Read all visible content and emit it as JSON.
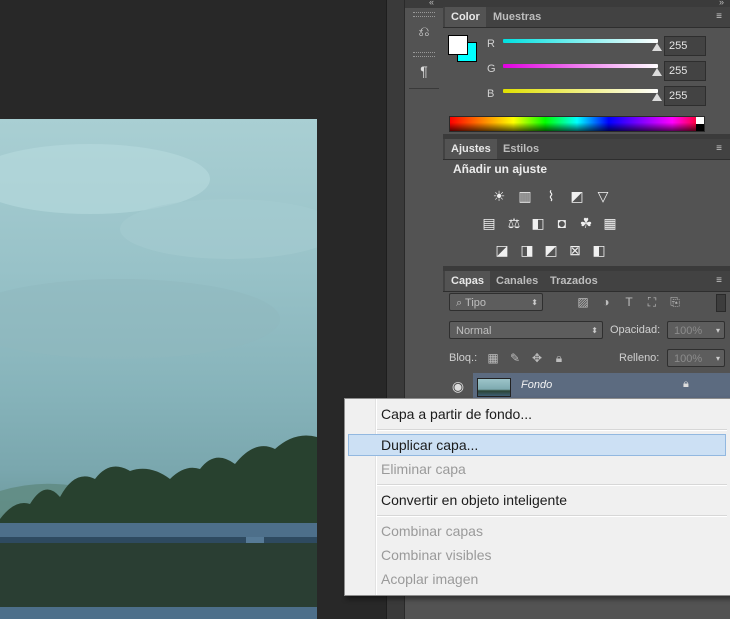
{
  "canvas": {
    "photo_desc": "landscape"
  },
  "toolstrip": {
    "icons": [
      "history-icon",
      "character-paragraph-icon"
    ]
  },
  "color_panel": {
    "tabs": [
      "Color",
      "Muestras"
    ],
    "channels": [
      {
        "label": "R",
        "value": "255",
        "color": "#00e0e0"
      },
      {
        "label": "G",
        "value": "255",
        "color": "#e000e0"
      },
      {
        "label": "B",
        "value": "255",
        "color": "#e0e000"
      }
    ]
  },
  "adjust_panel": {
    "tabs": [
      "Ajustes",
      "Estilos"
    ],
    "heading": "Añadir un ajuste"
  },
  "layers_panel": {
    "tabs": [
      "Capas",
      "Canales",
      "Trazados"
    ],
    "filter_label": "Tipo",
    "blend_mode": "Normal",
    "opacity_label": "Opacidad:",
    "opacity_value": "100%",
    "lock_label": "Bloq.:",
    "fill_label": "Relleno:",
    "fill_value": "100%",
    "layer_name": "Fondo"
  },
  "context_menu": {
    "items": [
      {
        "label": "Capa a partir de fondo...",
        "enabled": true
      },
      {
        "label": "Duplicar capa...",
        "enabled": true,
        "highlighted": true
      },
      {
        "label": "Eliminar capa",
        "enabled": false
      },
      {
        "label": "Convertir en objeto inteligente",
        "enabled": true
      },
      {
        "label": "Combinar capas",
        "enabled": false
      },
      {
        "label": "Combinar visibles",
        "enabled": false
      },
      {
        "label": "Acoplar imagen",
        "enabled": false
      }
    ]
  }
}
